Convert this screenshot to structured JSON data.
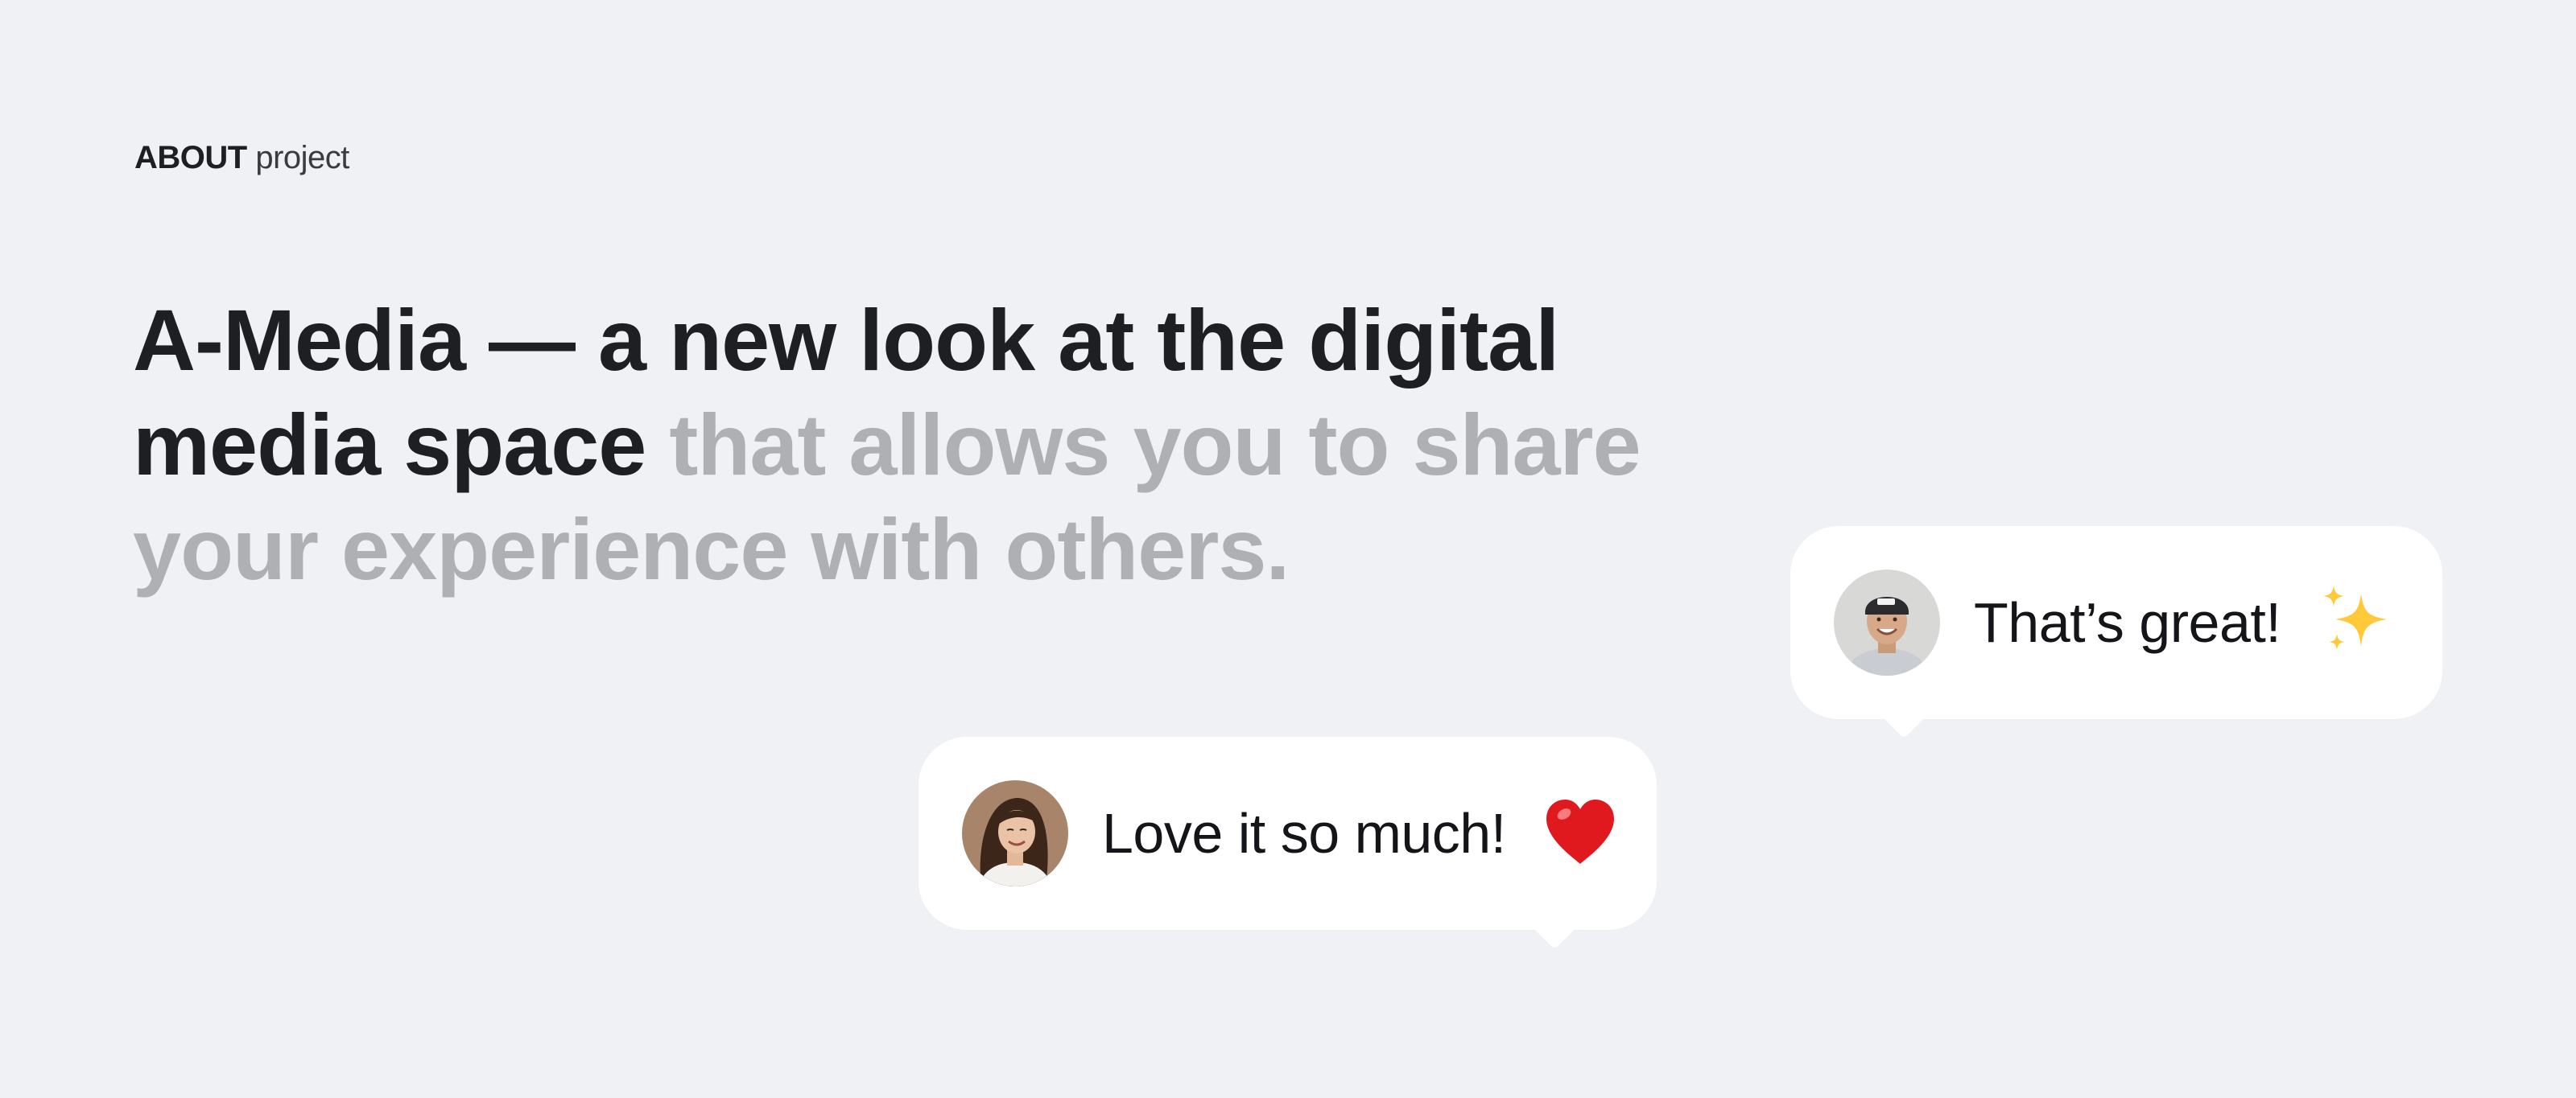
{
  "eyebrow": {
    "bold": "ABOUT",
    "light": "project"
  },
  "headline": {
    "line1": "A-Media — a new look at the digital",
    "line2_dark": "media space",
    "line2_muted": "that allows you to share",
    "line3_muted": "your experience with others."
  },
  "bubbles": [
    {
      "text": "That’s great!",
      "emoji": "sparkles-icon"
    },
    {
      "text": "Love it so much!",
      "emoji": "heart-icon"
    }
  ],
  "colors": {
    "background": "#f0f1f4",
    "text_dark": "#1e1f23",
    "text_muted": "#afb0b4",
    "bubble": "#ffffff",
    "heart": "#e0191f",
    "sparkle": "#ffc93a"
  }
}
